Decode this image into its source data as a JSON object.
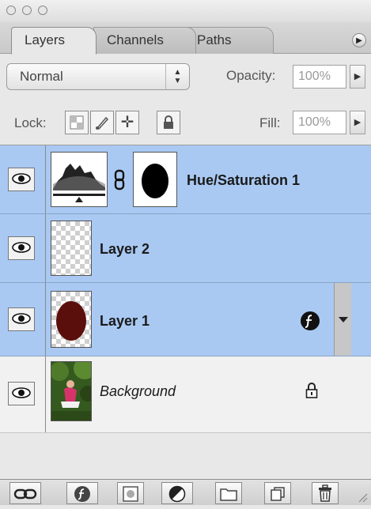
{
  "tabs": [
    {
      "label": "Layers",
      "active": true
    },
    {
      "label": "Channels",
      "active": false
    },
    {
      "label": "Paths",
      "active": false
    }
  ],
  "blend": {
    "mode": "Normal",
    "opacity_label": "Opacity:",
    "opacity_value": "100%"
  },
  "lock": {
    "label": "Lock:",
    "fill_label": "Fill:",
    "fill_value": "100%"
  },
  "layers": [
    {
      "name": "Hue/Saturation 1",
      "type": "adjustment",
      "selected": true,
      "visible": true
    },
    {
      "name": "Layer 2",
      "type": "pixel",
      "selected": true,
      "visible": true
    },
    {
      "name": "Layer 1",
      "type": "pixel",
      "selected": true,
      "visible": true,
      "has_effects": true
    },
    {
      "name": "Background",
      "type": "background",
      "selected": false,
      "visible": true,
      "locked": true
    }
  ],
  "icons": {
    "panel_menu": "panel-menu-icon",
    "bottom": [
      "link-layers-icon",
      "layer-style-icon",
      "layer-mask-icon",
      "adjustment-layer-icon",
      "new-group-icon",
      "new-layer-icon",
      "trash-icon"
    ]
  },
  "colors": {
    "selection": "#a9c9f3",
    "panel": "#e8e8e8"
  }
}
